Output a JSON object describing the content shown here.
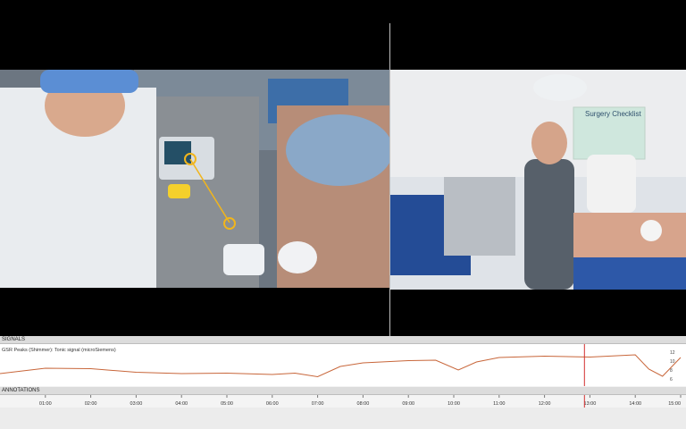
{
  "signals": {
    "header": "SIGNALS",
    "signal_name": "GSR Peaks (Shimmer): Tonic signal (microSiemens)",
    "y_ticks": [
      "12",
      "10",
      "8",
      "6"
    ],
    "trace_color": "#c8663a",
    "cursor_color": "#d32f2f",
    "cursor_time_min": 12.88
  },
  "annotations": {
    "header": "ANNOTATIONS"
  },
  "timeline": {
    "ticks": [
      "01:00",
      "02:00",
      "03:00",
      "04:00",
      "05:00",
      "06:00",
      "07:00",
      "08:00",
      "09:00",
      "10:00",
      "11:00",
      "12:00",
      "13:00",
      "14:00",
      "15:00"
    ]
  },
  "video_right": {
    "poster_text": "Surgery Checklist"
  },
  "chart_data": {
    "type": "line",
    "title": "",
    "xlabel": "",
    "ylabel": "",
    "series": [
      {
        "name": "GSR Peaks (Shimmer): Tonic signal (microSiemens)",
        "x": [
          0.0,
          1.0,
          2.0,
          3.0,
          4.0,
          5.0,
          6.0,
          6.5,
          7.0,
          7.5,
          8.0,
          9.0,
          9.6,
          10.1,
          10.5,
          11.0,
          12.0,
          13.0,
          14.0,
          14.3,
          14.6,
          15.0
        ],
        "values": [
          7.2,
          8.4,
          8.3,
          7.5,
          7.2,
          7.3,
          7.0,
          7.3,
          6.5,
          8.8,
          9.6,
          10.1,
          10.2,
          8.0,
          9.8,
          10.8,
          11.1,
          10.9,
          11.4,
          8.2,
          6.6,
          10.8
        ]
      }
    ],
    "xlim": [
      0,
      15
    ],
    "ylim": [
      5,
      13
    ]
  }
}
